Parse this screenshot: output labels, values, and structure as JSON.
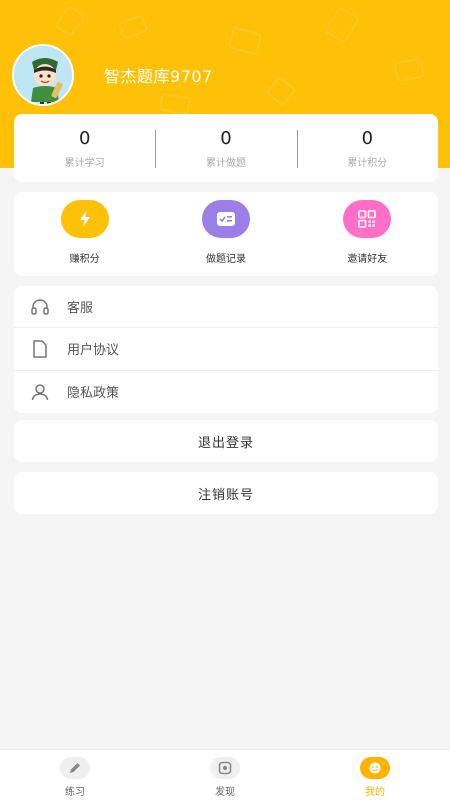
{
  "profile": {
    "name": "智杰题库9707"
  },
  "stats": [
    {
      "value": "0",
      "label": "累计学习"
    },
    {
      "value": "0",
      "label": "累计做题"
    },
    {
      "value": "0",
      "label": "累计积分"
    }
  ],
  "actions": [
    {
      "label": "赚积分",
      "icon": "lightning-icon",
      "color": "#ffc107"
    },
    {
      "label": "做题记录",
      "icon": "record-icon",
      "color": "#9b7ee8"
    },
    {
      "label": "邀请好友",
      "icon": "qrcode-icon",
      "color": "#ff6fc8"
    }
  ],
  "menu": [
    {
      "label": "客服",
      "icon": "headset-icon"
    },
    {
      "label": "用户协议",
      "icon": "document-icon"
    },
    {
      "label": "隐私政策",
      "icon": "user-icon"
    }
  ],
  "buttons": {
    "logout": "退出登录",
    "cancel_account": "注销账号"
  },
  "tabs": [
    {
      "label": "练习",
      "icon": "pencil-icon",
      "active": false
    },
    {
      "label": "发现",
      "icon": "discover-icon",
      "active": false
    },
    {
      "label": "我的",
      "icon": "profile-icon",
      "active": true
    }
  ],
  "colors": {
    "accent": "#ffc107",
    "tab_inactive": "#666666",
    "tab_active": "#ffb300",
    "background": "#f5f5f5"
  }
}
